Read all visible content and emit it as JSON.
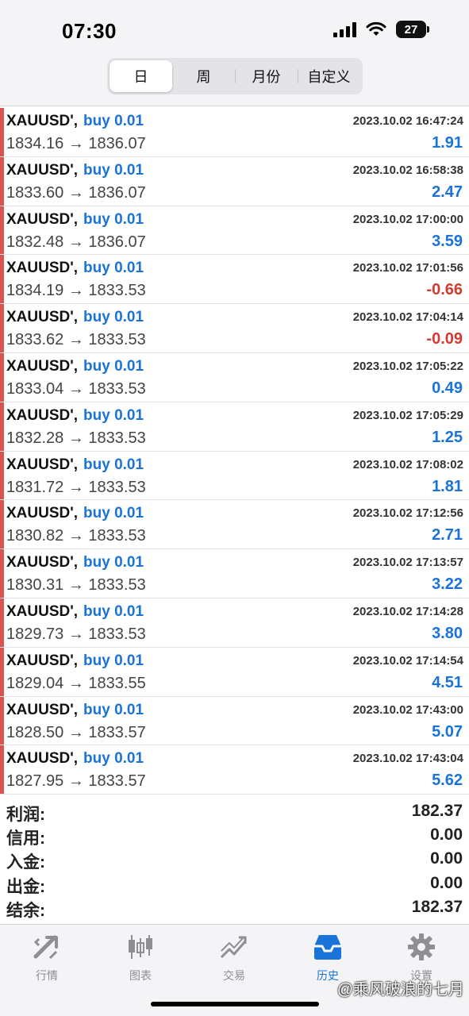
{
  "status_bar": {
    "time": "07:30",
    "battery": "27"
  },
  "segments": [
    {
      "label": "日",
      "active": true
    },
    {
      "label": "周",
      "active": false
    },
    {
      "label": "月份",
      "active": false
    },
    {
      "label": "自定义",
      "active": false
    }
  ],
  "trades": [
    {
      "symbol": "XAUUSD'",
      "side": "buy 0.01",
      "datetime": "2023.10.02 16:47:24",
      "open": "1834.16",
      "close": "1836.07",
      "profit": "1.91",
      "negative": false
    },
    {
      "symbol": "XAUUSD'",
      "side": "buy 0.01",
      "datetime": "2023.10.02 16:58:38",
      "open": "1833.60",
      "close": "1836.07",
      "profit": "2.47",
      "negative": false
    },
    {
      "symbol": "XAUUSD'",
      "side": "buy 0.01",
      "datetime": "2023.10.02 17:00:00",
      "open": "1832.48",
      "close": "1836.07",
      "profit": "3.59",
      "negative": false
    },
    {
      "symbol": "XAUUSD'",
      "side": "buy 0.01",
      "datetime": "2023.10.02 17:01:56",
      "open": "1834.19",
      "close": "1833.53",
      "profit": "-0.66",
      "negative": true
    },
    {
      "symbol": "XAUUSD'",
      "side": "buy 0.01",
      "datetime": "2023.10.02 17:04:14",
      "open": "1833.62",
      "close": "1833.53",
      "profit": "-0.09",
      "negative": true
    },
    {
      "symbol": "XAUUSD'",
      "side": "buy 0.01",
      "datetime": "2023.10.02 17:05:22",
      "open": "1833.04",
      "close": "1833.53",
      "profit": "0.49",
      "negative": false
    },
    {
      "symbol": "XAUUSD'",
      "side": "buy 0.01",
      "datetime": "2023.10.02 17:05:29",
      "open": "1832.28",
      "close": "1833.53",
      "profit": "1.25",
      "negative": false
    },
    {
      "symbol": "XAUUSD'",
      "side": "buy 0.01",
      "datetime": "2023.10.02 17:08:02",
      "open": "1831.72",
      "close": "1833.53",
      "profit": "1.81",
      "negative": false
    },
    {
      "symbol": "XAUUSD'",
      "side": "buy 0.01",
      "datetime": "2023.10.02 17:12:56",
      "open": "1830.82",
      "close": "1833.53",
      "profit": "2.71",
      "negative": false
    },
    {
      "symbol": "XAUUSD'",
      "side": "buy 0.01",
      "datetime": "2023.10.02 17:13:57",
      "open": "1830.31",
      "close": "1833.53",
      "profit": "3.22",
      "negative": false
    },
    {
      "symbol": "XAUUSD'",
      "side": "buy 0.01",
      "datetime": "2023.10.02 17:14:28",
      "open": "1829.73",
      "close": "1833.53",
      "profit": "3.80",
      "negative": false
    },
    {
      "symbol": "XAUUSD'",
      "side": "buy 0.01",
      "datetime": "2023.10.02 17:14:54",
      "open": "1829.04",
      "close": "1833.55",
      "profit": "4.51",
      "negative": false
    },
    {
      "symbol": "XAUUSD'",
      "side": "buy 0.01",
      "datetime": "2023.10.02 17:43:00",
      "open": "1828.50",
      "close": "1833.57",
      "profit": "5.07",
      "negative": false
    },
    {
      "symbol": "XAUUSD'",
      "side": "buy 0.01",
      "datetime": "2023.10.02 17:43:04",
      "open": "1827.95",
      "close": "1833.57",
      "profit": "5.62",
      "negative": false
    }
  ],
  "summary": [
    {
      "label": "利润:",
      "value": "182.37"
    },
    {
      "label": "信用:",
      "value": "0.00"
    },
    {
      "label": "入金:",
      "value": "0.00"
    },
    {
      "label": "出金:",
      "value": "0.00"
    },
    {
      "label": "结余:",
      "value": "182.37"
    }
  ],
  "tabs": [
    {
      "label": "行情",
      "icon": "quotes-icon",
      "active": false
    },
    {
      "label": "图表",
      "icon": "chart-icon",
      "active": false
    },
    {
      "label": "交易",
      "icon": "trade-icon",
      "active": false
    },
    {
      "label": "历史",
      "icon": "history-icon",
      "active": true
    },
    {
      "label": "设置",
      "icon": "settings-icon",
      "active": false
    }
  ],
  "watermark": "@乘风破浪的七月",
  "colors": {
    "accent": "#1a73d9",
    "loss": "#d43a30",
    "row_marker": "#d9534f"
  }
}
